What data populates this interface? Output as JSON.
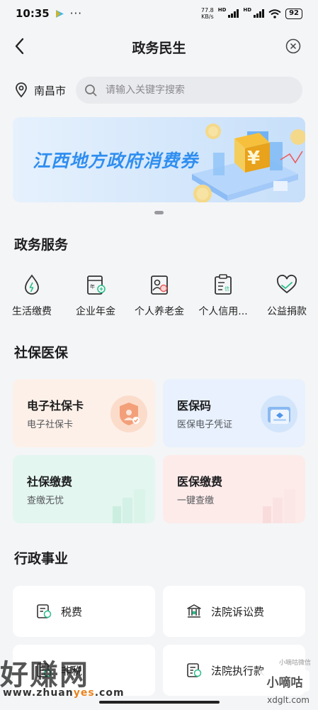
{
  "status_bar": {
    "time": "10:35",
    "dots": "···",
    "net_speed": "77.8",
    "net_speed_unit": "KB/s",
    "signal_label_1": "HD",
    "signal_label_2": "HD",
    "battery": "92"
  },
  "nav": {
    "title": "政务民生"
  },
  "location": {
    "city": "南昌市",
    "search_placeholder": "请输入关键字搜索"
  },
  "banner": {
    "text": "江西地方政府消费券",
    "page_indicator_active": 1,
    "page_count": 1
  },
  "gov_services": {
    "title": "政务服务",
    "items": [
      {
        "label": "生活缴费",
        "icon": "water-drop-icon"
      },
      {
        "label": "企业年金",
        "icon": "annuity-document-icon"
      },
      {
        "label": "个人养老金",
        "icon": "pension-icon"
      },
      {
        "label": "个人信用...",
        "icon": "credit-report-icon"
      },
      {
        "label": "公益捐款",
        "icon": "charity-heart-icon"
      }
    ]
  },
  "social_security": {
    "title": "社保医保",
    "cards": [
      {
        "title": "电子社保卡",
        "subtitle": "电子社保卡",
        "bg": "#fdf0e8",
        "icon": "social-security-card-icon"
      },
      {
        "title": "医保码",
        "subtitle": "医保电子凭证",
        "bg": "#e8f1fd",
        "icon": "medical-insurance-card-icon"
      },
      {
        "title": "社保缴费",
        "subtitle": "查缴无忧",
        "bg": "#e3f6ef",
        "icon": "bar-chart-icon"
      },
      {
        "title": "医保缴费",
        "subtitle": "一键查缴",
        "bg": "#fdebea",
        "icon": "bar-chart-icon"
      }
    ]
  },
  "admin": {
    "title": "行政事业",
    "tiles": [
      {
        "label": "税费",
        "icon": "tax-icon"
      },
      {
        "label": "法院诉讼费",
        "icon": "court-icon"
      },
      {
        "label": "非税",
        "icon": "non-tax-icon"
      },
      {
        "label": "法院执行款",
        "icon": "court-payment-icon"
      }
    ]
  },
  "watermarks": {
    "left_brand": "好赚网",
    "left_url_prefix": "www.zhuan",
    "left_url_highlight": "yes",
    "left_url_suffix": ".com",
    "right_small": "小嘀咕微信",
    "right_brand": "小嘀咕",
    "right_url": "xdglt.com"
  },
  "colors": {
    "accent_blue": "#2f8ef0",
    "page_bg": "#f4f5f7"
  }
}
